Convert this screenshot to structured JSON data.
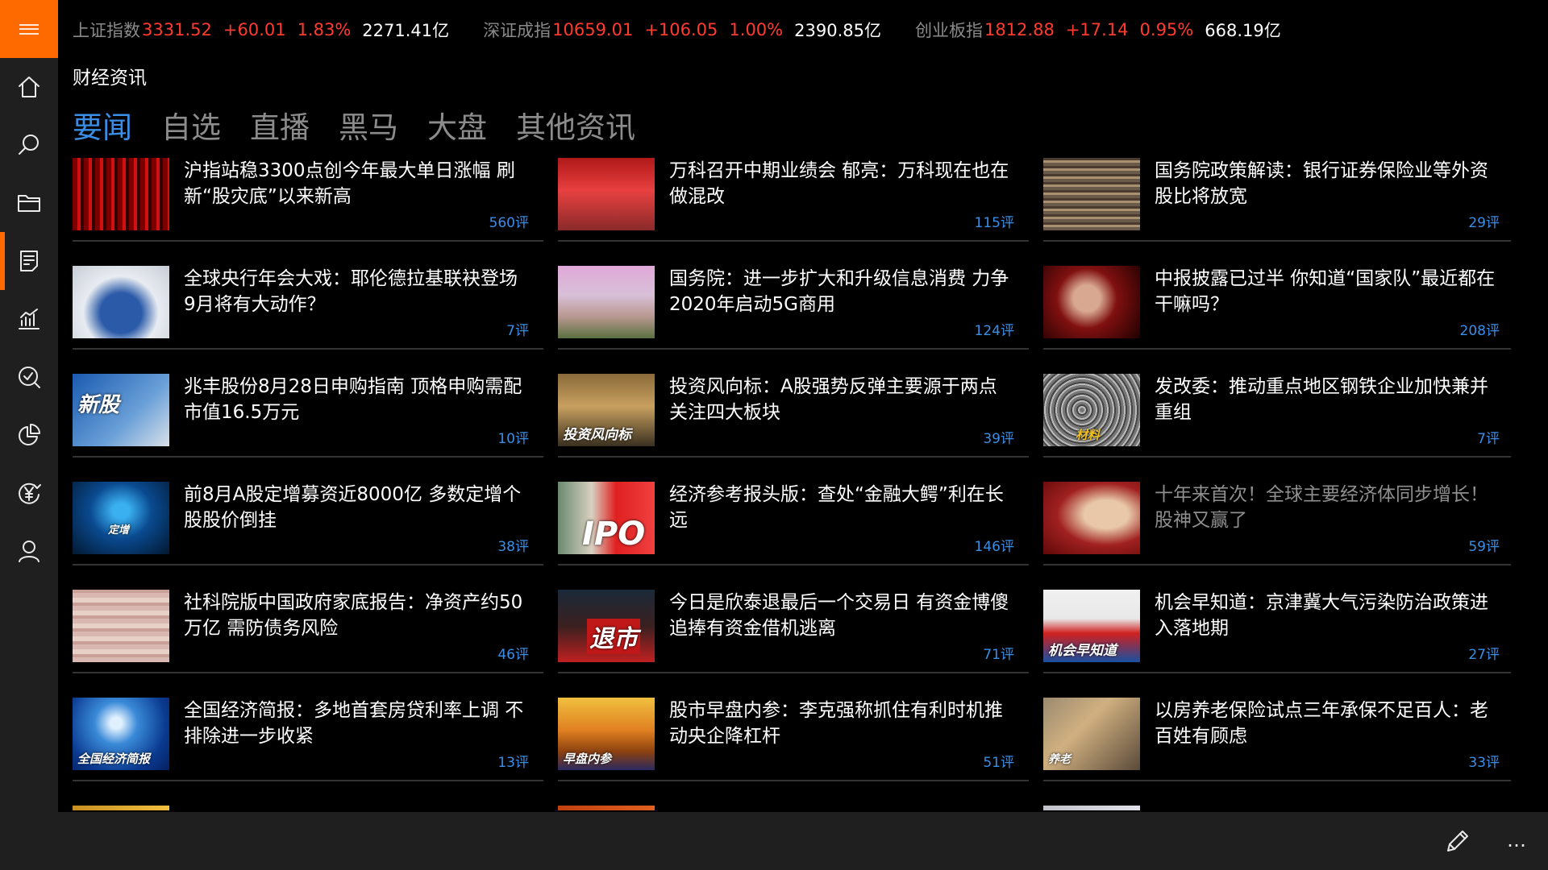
{
  "ticker": [
    {
      "name": "上证指数",
      "value": "3331.52",
      "change": "+60.01",
      "percent": "1.83%",
      "amount": "2271.41亿"
    },
    {
      "name": "深证成指",
      "value": "10659.01",
      "change": "+106.05",
      "percent": "1.00%",
      "amount": "2390.85亿"
    },
    {
      "name": "创业板指",
      "value": "1812.88",
      "change": "+17.14",
      "percent": "0.95%",
      "amount": "668.19亿"
    }
  ],
  "section_title": "财经资讯",
  "tabs": [
    "要闻",
    "自选",
    "直播",
    "黑马",
    "大盘",
    "其他资讯"
  ],
  "news": [
    {
      "title": "沪指站稳3300点创今年最大单日涨幅 刷新“股灾底”以来新高",
      "comments": "560评"
    },
    {
      "title": "万科召开中期业绩会 郁亮：万科现在也在做混改",
      "comments": "115评"
    },
    {
      "title": "国务院政策解读：银行证券保险业等外资股比将放宽",
      "comments": "29评"
    },
    {
      "title": "全球央行年会大戏：耶伦德拉基联袂登场 9月将有大动作？",
      "comments": "7评"
    },
    {
      "title": "国务院：进一步扩大和升级信息消费 力争2020年启动5G商用",
      "comments": "124评"
    },
    {
      "title": "中报披露已过半 你知道“国家队”最近都在干嘛吗？",
      "comments": "208评"
    },
    {
      "title": "兆丰股份8月28日申购指南 顶格申购需配市值16.5万元",
      "comments": "10评",
      "thumb_caption": "新股"
    },
    {
      "title": "投资风向标：A股强势反弹主要源于两点 关注四大板块",
      "comments": "39评",
      "thumb_caption": "投资风向标"
    },
    {
      "title": "发改委：推动重点地区钢铁企业加快兼并重组",
      "comments": "7评",
      "thumb_caption": "材料"
    },
    {
      "title": "前8月A股定增募资近8000亿 多数定增个股股价倒挂",
      "comments": "38评",
      "thumb_caption": "定增"
    },
    {
      "title": "经济参考报头版：查处“金融大鳄”利在长远",
      "comments": "146评",
      "thumb_caption": "IPO"
    },
    {
      "title": "十年来首次！全球主要经济体同步增长！股神又赢了",
      "comments": "59评"
    },
    {
      "title": "社科院版中国政府家底报告：净资产约50万亿 需防债务风险",
      "comments": "46评"
    },
    {
      "title": "今日是欣泰退最后一个交易日 有资金博傻追捧有资金借机逃离",
      "comments": "71评",
      "thumb_caption": "退市"
    },
    {
      "title": "机会早知道：京津冀大气污染防治政策进入落地期",
      "comments": "27评",
      "thumb_caption": "机会早知道"
    },
    {
      "title": "全国经济简报：多地首套房贷利率上调 不排除进一步收紧",
      "comments": "13评",
      "thumb_caption": "全国经济简报"
    },
    {
      "title": "股市早盘内参：李克强称抓住有利时机推动央企降杠杆",
      "comments": "51评",
      "thumb_caption": "早盘内参"
    },
    {
      "title": "以房养老保险试点三年承保不足百人：老百姓有顾虑",
      "comments": "33评",
      "thumb_caption": "养老"
    }
  ],
  "colors": {
    "accent": "#ff6a00",
    "up": "#ff3b30",
    "link": "#3a8ee6"
  },
  "sidebar_icons": [
    "home-icon",
    "search-icon",
    "folder-icon",
    "news-icon",
    "chart-icon",
    "magnify-check-icon",
    "pie-icon",
    "yuan-icon",
    "user-icon"
  ]
}
